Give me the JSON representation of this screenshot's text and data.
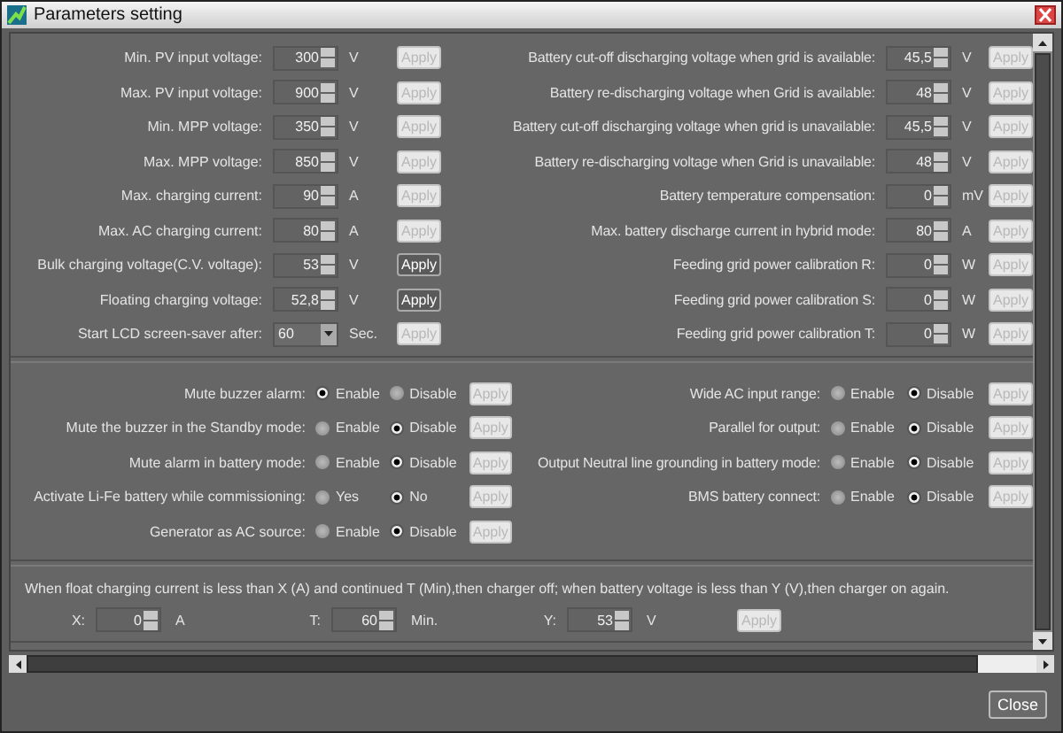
{
  "window": {
    "title": "Parameters setting"
  },
  "numeric_settings": {
    "left": [
      {
        "kind": "spinner",
        "label": "Min. PV input voltage:",
        "value": "300",
        "unit": "V",
        "apply_label": "Apply",
        "apply_disabled": true
      },
      {
        "kind": "spinner",
        "label": "Max. PV input voltage:",
        "value": "900",
        "unit": "V",
        "apply_label": "Apply",
        "apply_disabled": true
      },
      {
        "kind": "spinner",
        "label": "Min. MPP voltage:",
        "value": "350",
        "unit": "V",
        "apply_label": "Apply",
        "apply_disabled": true
      },
      {
        "kind": "spinner",
        "label": "Max. MPP voltage:",
        "value": "850",
        "unit": "V",
        "apply_label": "Apply",
        "apply_disabled": true
      },
      {
        "kind": "spinner",
        "label": "Max. charging current:",
        "value": "90",
        "unit": "A",
        "apply_label": "Apply",
        "apply_disabled": true
      },
      {
        "kind": "spinner",
        "label": "Max. AC charging current:",
        "value": "80",
        "unit": "A",
        "apply_label": "Apply",
        "apply_disabled": true
      },
      {
        "kind": "spinner",
        "label": "Bulk charging voltage(C.V. voltage):",
        "value": "53",
        "unit": "V",
        "apply_label": "Apply",
        "apply_disabled": false
      },
      {
        "kind": "spinner",
        "label": "Floating charging voltage:",
        "value": "52,8",
        "unit": "V",
        "apply_label": "Apply",
        "apply_disabled": false
      },
      {
        "kind": "dropdown",
        "label": "Start LCD screen-saver after:",
        "value": "60",
        "unit": "Sec.",
        "apply_label": "Apply",
        "apply_disabled": true
      }
    ],
    "right": [
      {
        "kind": "spinner",
        "label": "Battery cut-off discharging voltage when grid is available:",
        "value": "45,5",
        "unit": "V",
        "apply_label": "Apply",
        "apply_disabled": true
      },
      {
        "kind": "spinner",
        "label": "Battery re-discharging voltage when Grid is available:",
        "value": "48",
        "unit": "V",
        "apply_label": "Apply",
        "apply_disabled": true
      },
      {
        "kind": "spinner",
        "label": "Battery cut-off discharging voltage when grid is unavailable:",
        "value": "45,5",
        "unit": "V",
        "apply_label": "Apply",
        "apply_disabled": true
      },
      {
        "kind": "spinner",
        "label": "Battery re-discharging voltage when Grid is unavailable:",
        "value": "48",
        "unit": "V",
        "apply_label": "Apply",
        "apply_disabled": true
      },
      {
        "kind": "spinner",
        "label": "Battery temperature compensation:",
        "value": "0",
        "unit": "mV",
        "apply_label": "Apply",
        "apply_disabled": true
      },
      {
        "kind": "spinner",
        "label": "Max. battery discharge current in hybrid mode:",
        "value": "80",
        "unit": "A",
        "apply_label": "Apply",
        "apply_disabled": true
      },
      {
        "kind": "spinner",
        "label": "Feeding grid power calibration R:",
        "value": "0",
        "unit": "W",
        "apply_label": "Apply",
        "apply_disabled": true
      },
      {
        "kind": "spinner",
        "label": "Feeding grid power calibration S:",
        "value": "0",
        "unit": "W",
        "apply_label": "Apply",
        "apply_disabled": true
      },
      {
        "kind": "spinner",
        "label": "Feeding grid power calibration T:",
        "value": "0",
        "unit": "W",
        "apply_label": "Apply",
        "apply_disabled": true
      }
    ]
  },
  "toggle_settings": {
    "left": [
      {
        "label": "Mute buzzer alarm:",
        "options": [
          {
            "label": "Enable",
            "selected": true
          },
          {
            "label": "Disable",
            "selected": false
          }
        ],
        "apply_label": "Apply",
        "apply_disabled": true
      },
      {
        "label": "Mute the buzzer in the Standby mode:",
        "options": [
          {
            "label": "Enable",
            "selected": false
          },
          {
            "label": "Disable",
            "selected": true
          }
        ],
        "apply_label": "Apply",
        "apply_disabled": true
      },
      {
        "label": "Mute alarm in battery mode:",
        "options": [
          {
            "label": "Enable",
            "selected": false
          },
          {
            "label": "Disable",
            "selected": true
          }
        ],
        "apply_label": "Apply",
        "apply_disabled": true
      },
      {
        "label": "Activate Li-Fe battery while commissioning:",
        "options": [
          {
            "label": "Yes",
            "selected": false
          },
          {
            "label": "No",
            "selected": true
          }
        ],
        "apply_label": "Apply",
        "apply_disabled": true
      },
      {
        "label": "Generator as AC source:",
        "options": [
          {
            "label": "Enable",
            "selected": false
          },
          {
            "label": "Disable",
            "selected": true
          }
        ],
        "apply_label": "Apply",
        "apply_disabled": true
      }
    ],
    "right": [
      {
        "label": "Wide AC input range:",
        "options": [
          {
            "label": "Enable",
            "selected": false
          },
          {
            "label": "Disable",
            "selected": true
          }
        ],
        "apply_label": "Apply",
        "apply_disabled": true
      },
      {
        "label": "Parallel for output:",
        "options": [
          {
            "label": "Enable",
            "selected": false
          },
          {
            "label": "Disable",
            "selected": true
          }
        ],
        "apply_label": "Apply",
        "apply_disabled": true
      },
      {
        "label": "Output Neutral line grounding in battery mode:",
        "options": [
          {
            "label": "Enable",
            "selected": false
          },
          {
            "label": "Disable",
            "selected": true
          }
        ],
        "apply_label": "Apply",
        "apply_disabled": true
      },
      {
        "label": "BMS battery connect:",
        "options": [
          {
            "label": "Enable",
            "selected": false
          },
          {
            "label": "Disable",
            "selected": true
          }
        ],
        "apply_label": "Apply",
        "apply_disabled": true
      }
    ]
  },
  "float_charging": {
    "description": "When float charging current is less than X (A) and continued T (Min),then charger off; when battery voltage is less than Y (V),then charger on again.",
    "fields": [
      {
        "label": "X:",
        "value": "0",
        "unit": "A"
      },
      {
        "label": "T:",
        "value": "60",
        "unit": "Min."
      },
      {
        "label": "Y:",
        "value": "53",
        "unit": "V"
      }
    ],
    "apply_label": "Apply",
    "apply_disabled": true
  },
  "close_button": "Close"
}
